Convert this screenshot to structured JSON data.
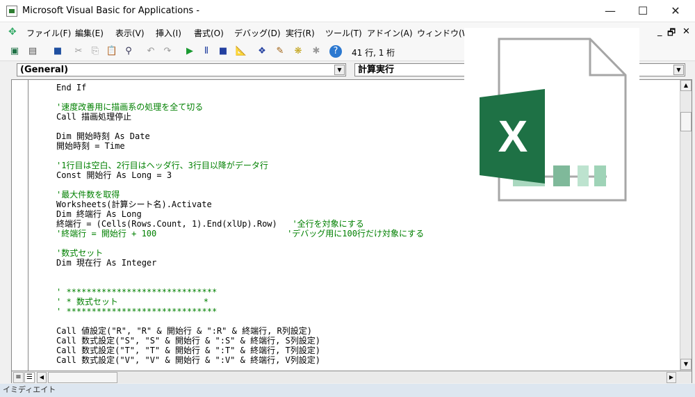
{
  "window": {
    "title": "Microsoft Visual Basic for Applications -",
    "minimize": "—",
    "maximize": "☐",
    "close": "✕"
  },
  "menu": [
    "ファイル(F)",
    "編集(E)",
    "表示(V)",
    "挿入(I)",
    "書式(O)",
    "デバッグ(D)",
    "実行(R)",
    "ツール(T)",
    "アドイン(A)",
    "ウィンドウ(W)"
  ],
  "mdi": {
    "minimize": "_",
    "restore": "🗗",
    "close": "✕"
  },
  "toolbar": {
    "position": "41 行, 1 桁"
  },
  "object_combo": "(General)",
  "procedure_combo": "計算実行",
  "code_lines": [
    {
      "t": "End If",
      "c": ""
    },
    {
      "t": "",
      "c": ""
    },
    {
      "t": "",
      "c": "'速度改善用に描画系の処理を全て切る"
    },
    {
      "t": "Call 描画処理停止",
      "c": ""
    },
    {
      "t": "",
      "c": ""
    },
    {
      "t": "Dim 開始時刻 As Date",
      "c": ""
    },
    {
      "t": "開始時刻 = Time",
      "c": ""
    },
    {
      "t": "",
      "c": ""
    },
    {
      "t": "",
      "c": "'1行目は空白、2行目はヘッダ行、3行目以降がデータ行"
    },
    {
      "t": "Const 開始行 As Long = 3",
      "c": ""
    },
    {
      "t": "",
      "c": ""
    },
    {
      "t": "",
      "c": "'最大件数を取得"
    },
    {
      "t": "Worksheets(計算シート名).Activate",
      "c": ""
    },
    {
      "t": "Dim 終端行 As Long",
      "c": ""
    },
    {
      "t": "終端行 = (Cells(Rows.Count, 1).End(xlUp).Row)   ",
      "c": "'全行を対象にする"
    },
    {
      "t": "",
      "c": "'終端行 = 開始行 + 100                          'デバッグ用に100行だけ対象にする"
    },
    {
      "t": "",
      "c": ""
    },
    {
      "t": "",
      "c": "'数式セット"
    },
    {
      "t": "Dim 現在行 As Integer",
      "c": ""
    },
    {
      "t": "",
      "c": ""
    },
    {
      "t": "",
      "c": ""
    },
    {
      "t": "",
      "c": "' ******************************"
    },
    {
      "t": "",
      "c": "' * 数式セット                 *"
    },
    {
      "t": "",
      "c": "' ******************************"
    },
    {
      "t": "",
      "c": ""
    },
    {
      "t": "Call 値設定(\"R\", \"R\" & 開始行 & \":R\" & 終端行, R列設定)",
      "c": ""
    },
    {
      "t": "Call 数式設定(\"S\", \"S\" & 開始行 & \":S\" & 終端行, S列設定)",
      "c": ""
    },
    {
      "t": "Call 数式設定(\"T\", \"T\" & 開始行 & \":T\" & 終端行, T列設定)",
      "c": ""
    },
    {
      "t": "Call 数式設定(\"V\", \"V\" & 開始行 & \":V\" & 終端行, V列設定)",
      "c": ""
    }
  ],
  "immediate_label": "イミディエイト",
  "overlay_logo": {
    "letter": "X",
    "color": "#1e7145"
  },
  "colors": {
    "comment": "#008000",
    "excel_green": "#1e7145"
  }
}
